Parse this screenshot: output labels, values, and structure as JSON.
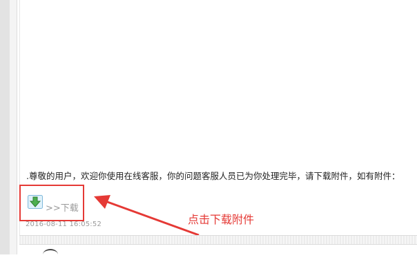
{
  "message": {
    "text": ".尊敬的用户，欢迎你使用在线客服，你的问题客服人员已为你处理完毕，请下载附件，如有附件："
  },
  "attachment": {
    "download_label": ">>下载",
    "icon": "download-arrow-icon"
  },
  "timestamp": "2016-08-11 16:05:52",
  "annotation": {
    "text": "点击下载附件",
    "color": "#e53935"
  }
}
